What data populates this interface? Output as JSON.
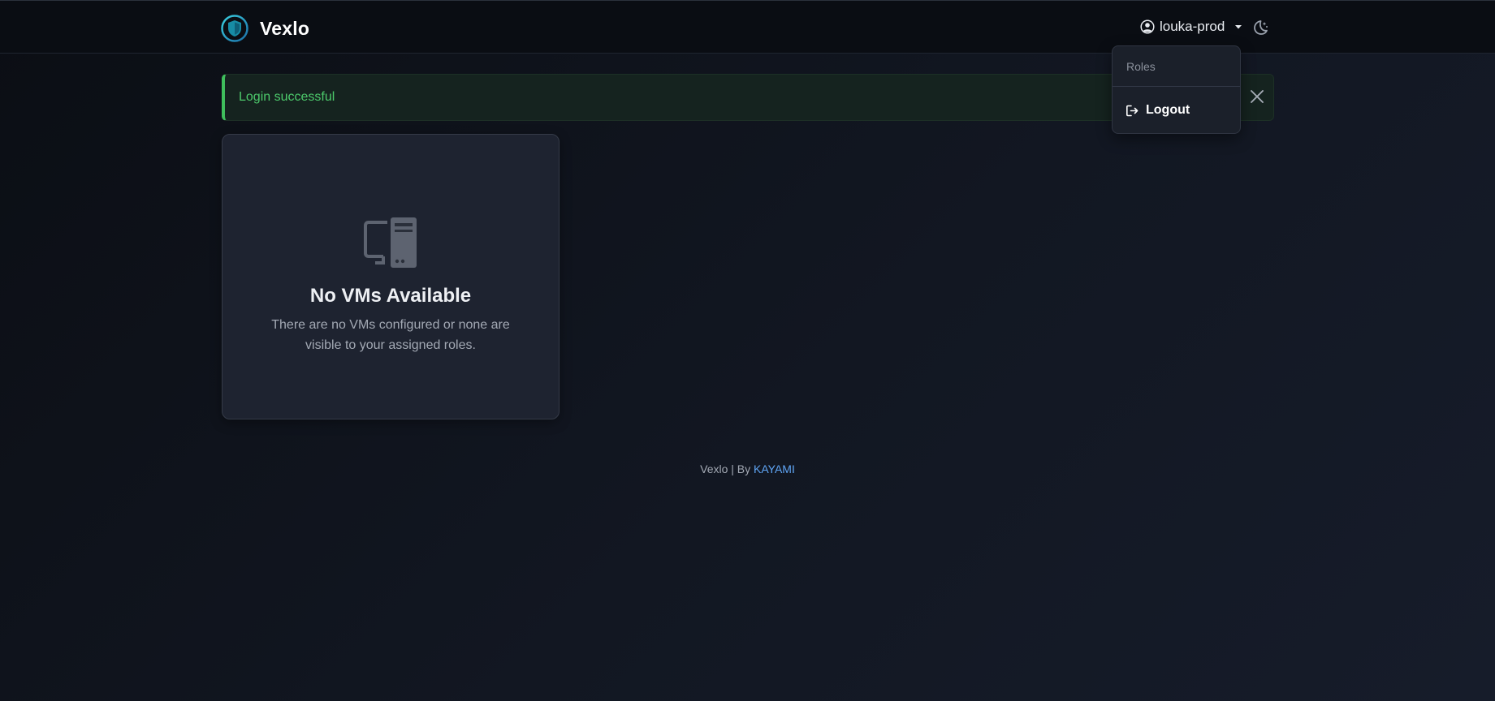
{
  "app": {
    "name": "Vexlo",
    "accent": "#2fb6c9"
  },
  "header": {
    "username": "louka-prod",
    "user_icon": "user-circle-icon",
    "caret_icon": "caret-down-icon",
    "theme_icon": "moon-stars-icon"
  },
  "user_menu": {
    "header": "Roles",
    "items": [
      {
        "label": "Logout",
        "icon": "logout-icon"
      }
    ]
  },
  "alert": {
    "message": "Login successful",
    "color": "#4cc96b",
    "close_icon": "close-icon"
  },
  "empty_state": {
    "icon": "computer-tower-icon",
    "title": "No VMs Available",
    "description": "There are no VMs configured or none are visible to your assigned roles."
  },
  "footer": {
    "text": "Vexlo | By ",
    "link_label": "KAYAMI",
    "link_color": "#5fa5f5"
  }
}
